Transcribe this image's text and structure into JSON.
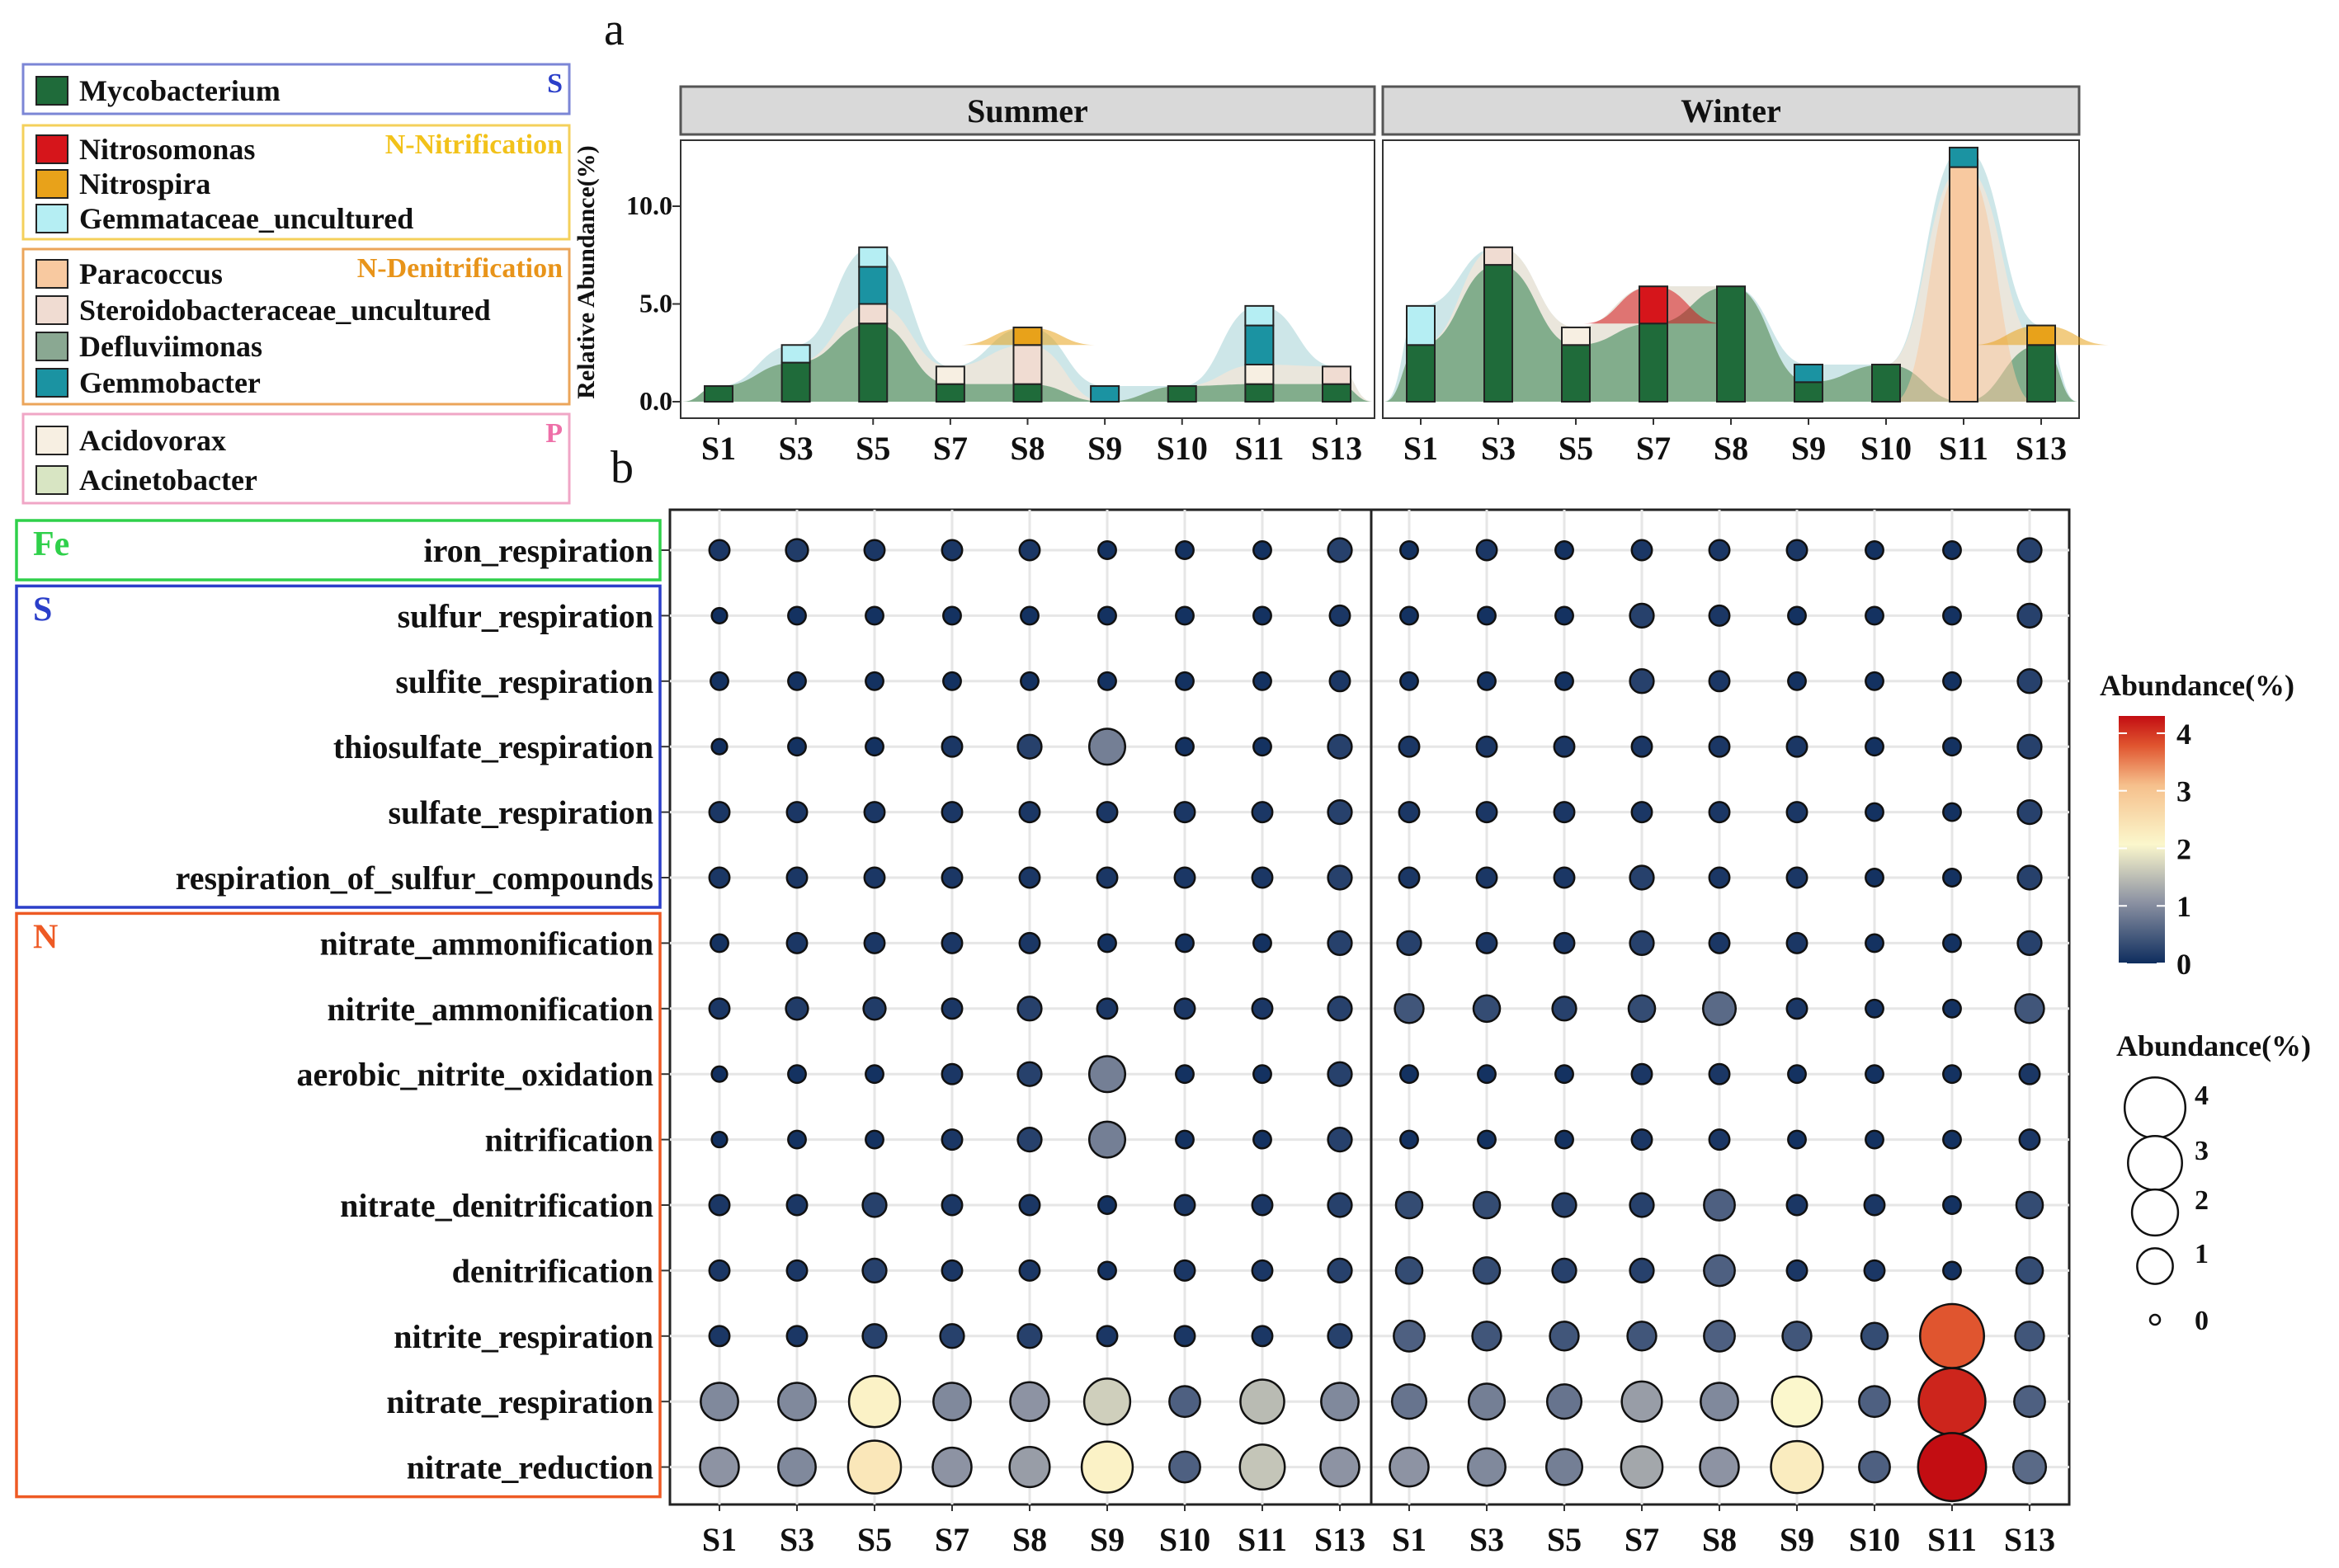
{
  "panel_labels": {
    "a": "a",
    "b": "b"
  },
  "chart_data": [
    {
      "type": "area",
      "panel": "a",
      "facets": [
        "Summer",
        "Winter"
      ],
      "ylabel": "Relative Abundance(%)",
      "ylim": [
        0,
        14
      ],
      "yticks": [
        "0.0",
        "5.0",
        "10.0"
      ],
      "categories": [
        "S1",
        "S3",
        "S5",
        "S7",
        "S8",
        "S9",
        "S10",
        "S11",
        "S13"
      ],
      "legend_groups": [
        {
          "tag": "S",
          "tag_color": "#2b3fc9",
          "border": "#7b86d6",
          "items": [
            {
              "name": "Mycobacterium",
              "color": "#1f6b3a"
            }
          ]
        },
        {
          "tag": "N-Nitrification",
          "tag_color": "#f2c21a",
          "border": "#f4d05b",
          "items": [
            {
              "name": "Nitrosomonas",
              "color": "#d6151b"
            },
            {
              "name": "Nitrospira",
              "color": "#e8a21a"
            },
            {
              "name": "Gemmataceae_uncultured",
              "color": "#b5eef3"
            }
          ]
        },
        {
          "tag": "N-Denitrification",
          "tag_color": "#e8941a",
          "border": "#eba55a",
          "items": [
            {
              "name": "Paracoccus",
              "color": "#f8c9a0"
            },
            {
              "name": "Steroidobacteraceae_uncultured",
              "color": "#f0dcd2"
            },
            {
              "name": "Defluviimonas",
              "color": "#8aa892"
            },
            {
              "name": "Gemmobacter",
              "color": "#1b93a2"
            }
          ]
        },
        {
          "tag": "P",
          "tag_color": "#ee6fa8",
          "border": "#f0a6c6",
          "items": [
            {
              "name": "Acidovorax",
              "color": "#f7efe2"
            },
            {
              "name": "Acinetobacter",
              "color": "#d8e5c3"
            }
          ]
        }
      ],
      "bars": {
        "Summer": [
          [
            {
              "taxon": "Mycobacterium",
              "value": 0.8
            }
          ],
          [
            {
              "taxon": "Mycobacterium",
              "value": 2.0
            },
            {
              "taxon": "Gemmataceae_uncultured",
              "value": 0.9
            }
          ],
          [
            {
              "taxon": "Mycobacterium",
              "value": 4.0
            },
            {
              "taxon": "Steroidobacteraceae_uncultured",
              "value": 1.0
            },
            {
              "taxon": "Gemmobacter",
              "value": 1.9
            },
            {
              "taxon": "Gemmataceae_uncultured",
              "value": 1.0
            }
          ],
          [
            {
              "taxon": "Mycobacterium",
              "value": 0.9
            },
            {
              "taxon": "Acidovorax",
              "value": 0.9
            }
          ],
          [
            {
              "taxon": "Mycobacterium",
              "value": 0.9
            },
            {
              "taxon": "Steroidobacteraceae_uncultured",
              "value": 2.0
            },
            {
              "taxon": "Nitrospira",
              "value": 0.9
            }
          ],
          [
            {
              "taxon": "Gemmobacter",
              "value": 0.8
            }
          ],
          [
            {
              "taxon": "Mycobacterium",
              "value": 0.8
            }
          ],
          [
            {
              "taxon": "Mycobacterium",
              "value": 0.9
            },
            {
              "taxon": "Acidovorax",
              "value": 1.0
            },
            {
              "taxon": "Gemmobacter",
              "value": 2.0
            },
            {
              "taxon": "Gemmataceae_uncultured",
              "value": 1.0
            }
          ],
          [
            {
              "taxon": "Mycobacterium",
              "value": 0.9
            },
            {
              "taxon": "Steroidobacteraceae_uncultured",
              "value": 0.9
            }
          ]
        ],
        "Winter": [
          [
            {
              "taxon": "Mycobacterium",
              "value": 2.9
            },
            {
              "taxon": "Gemmataceae_uncultured",
              "value": 2.0
            }
          ],
          [
            {
              "taxon": "Mycobacterium",
              "value": 7.0
            },
            {
              "taxon": "Steroidobacteraceae_uncultured",
              "value": 0.9
            }
          ],
          [
            {
              "taxon": "Mycobacterium",
              "value": 2.9
            },
            {
              "taxon": "Acidovorax",
              "value": 0.9
            }
          ],
          [
            {
              "taxon": "Mycobacterium",
              "value": 4.0
            },
            {
              "taxon": "Nitrosomonas",
              "value": 1.9
            }
          ],
          [
            {
              "taxon": "Mycobacterium",
              "value": 5.9
            }
          ],
          [
            {
              "taxon": "Mycobacterium",
              "value": 1.0
            },
            {
              "taxon": "Gemmobacter",
              "value": 0.9
            }
          ],
          [
            {
              "taxon": "Mycobacterium",
              "value": 1.9
            }
          ],
          [
            {
              "taxon": "Paracoccus",
              "value": 12.0
            },
            {
              "taxon": "Gemmobacter",
              "value": 1.0
            }
          ],
          [
            {
              "taxon": "Mycobacterium",
              "value": 2.9
            },
            {
              "taxon": "Nitrospira",
              "value": 1.0
            }
          ]
        ]
      }
    },
    {
      "type": "scatter",
      "subtype": "bubble",
      "panel": "b",
      "categories": [
        "S1",
        "S3",
        "S5",
        "S7",
        "S8",
        "S9",
        "S10",
        "S11",
        "S13"
      ],
      "facets": [
        "Summer",
        "Winter"
      ],
      "row_groups": [
        {
          "tag": "Fe",
          "color": "#2fd04a",
          "rows": [
            "iron_respiration"
          ]
        },
        {
          "tag": "S",
          "color": "#2b3fc9",
          "rows": [
            "sulfur_respiration",
            "sulfite_respiration",
            "thiosulfate_respiration",
            "sulfate_respiration",
            "respiration_of_sulfur_compounds"
          ]
        },
        {
          "tag": "N",
          "color": "#ee5a24",
          "rows": [
            "nitrate_ammonification",
            "nitrite_ammonification",
            "aerobic_nitrite_oxidation",
            "nitrification",
            "nitrate_denitrification",
            "denitrification",
            "nitrite_respiration",
            "nitrate_respiration",
            "nitrate_reduction"
          ]
        }
      ],
      "functions": [
        "iron_respiration",
        "sulfur_respiration",
        "sulfite_respiration",
        "thiosulfate_respiration",
        "sulfate_respiration",
        "respiration_of_sulfur_compounds",
        "nitrate_ammonification",
        "nitrite_ammonification",
        "aerobic_nitrite_oxidation",
        "nitrification",
        "nitrate_denitrification",
        "denitrification",
        "nitrite_respiration",
        "nitrate_respiration",
        "nitrate_reduction"
      ],
      "values": {
        "Summer": [
          [
            0.1,
            0.15,
            0.1,
            0.1,
            0.1,
            0.05,
            0.05,
            0.05,
            0.2
          ],
          [
            0.02,
            0.05,
            0.05,
            0.05,
            0.05,
            0.05,
            0.05,
            0.05,
            0.1
          ],
          [
            0.05,
            0.05,
            0.05,
            0.05,
            0.05,
            0.05,
            0.05,
            0.05,
            0.1
          ],
          [
            0.02,
            0.05,
            0.05,
            0.1,
            0.2,
            0.8,
            0.05,
            0.05,
            0.2
          ],
          [
            0.1,
            0.1,
            0.1,
            0.1,
            0.1,
            0.1,
            0.1,
            0.1,
            0.2
          ],
          [
            0.1,
            0.1,
            0.1,
            0.1,
            0.1,
            0.1,
            0.1,
            0.1,
            0.2
          ],
          [
            0.05,
            0.1,
            0.1,
            0.1,
            0.1,
            0.05,
            0.05,
            0.05,
            0.2
          ],
          [
            0.1,
            0.15,
            0.15,
            0.1,
            0.2,
            0.1,
            0.1,
            0.1,
            0.2
          ],
          [
            0.02,
            0.05,
            0.05,
            0.1,
            0.2,
            0.8,
            0.05,
            0.05,
            0.2
          ],
          [
            0.02,
            0.05,
            0.05,
            0.1,
            0.2,
            0.8,
            0.05,
            0.05,
            0.2
          ],
          [
            0.1,
            0.1,
            0.2,
            0.1,
            0.1,
            0.05,
            0.1,
            0.1,
            0.2
          ],
          [
            0.1,
            0.1,
            0.2,
            0.1,
            0.1,
            0.05,
            0.1,
            0.1,
            0.2
          ],
          [
            0.1,
            0.1,
            0.2,
            0.2,
            0.2,
            0.1,
            0.1,
            0.1,
            0.2
          ],
          [
            0.9,
            0.9,
            2.1,
            0.9,
            1.0,
            1.6,
            0.5,
            1.4,
            0.9
          ],
          [
            1.0,
            0.9,
            2.3,
            1.0,
            1.1,
            2.1,
            0.5,
            1.5,
            1.0
          ]
        ],
        "Winter": [
          [
            0.05,
            0.1,
            0.05,
            0.1,
            0.1,
            0.1,
            0.05,
            0.05,
            0.2
          ],
          [
            0.05,
            0.05,
            0.05,
            0.2,
            0.1,
            0.05,
            0.05,
            0.05,
            0.2
          ],
          [
            0.05,
            0.05,
            0.05,
            0.2,
            0.1,
            0.05,
            0.05,
            0.05,
            0.2
          ],
          [
            0.1,
            0.1,
            0.1,
            0.1,
            0.1,
            0.1,
            0.05,
            0.05,
            0.2
          ],
          [
            0.1,
            0.1,
            0.1,
            0.1,
            0.1,
            0.1,
            0.05,
            0.05,
            0.2
          ],
          [
            0.1,
            0.1,
            0.1,
            0.2,
            0.1,
            0.1,
            0.05,
            0.05,
            0.2
          ],
          [
            0.2,
            0.1,
            0.1,
            0.2,
            0.1,
            0.1,
            0.05,
            0.05,
            0.2
          ],
          [
            0.4,
            0.3,
            0.2,
            0.3,
            0.6,
            0.1,
            0.05,
            0.05,
            0.4
          ],
          [
            0.05,
            0.05,
            0.05,
            0.1,
            0.1,
            0.05,
            0.05,
            0.05,
            0.1
          ],
          [
            0.05,
            0.05,
            0.05,
            0.1,
            0.1,
            0.05,
            0.05,
            0.05,
            0.1
          ],
          [
            0.3,
            0.3,
            0.2,
            0.2,
            0.5,
            0.1,
            0.1,
            0.05,
            0.3
          ],
          [
            0.3,
            0.3,
            0.2,
            0.2,
            0.5,
            0.1,
            0.1,
            0.05,
            0.3
          ],
          [
            0.5,
            0.4,
            0.4,
            0.4,
            0.5,
            0.4,
            0.3,
            3.7,
            0.4
          ],
          [
            0.7,
            0.8,
            0.7,
            1.1,
            0.9,
            2.0,
            0.5,
            4.1,
            0.5
          ],
          [
            1.0,
            0.9,
            0.8,
            1.2,
            1.0,
            2.2,
            0.5,
            4.3,
            0.6
          ]
        ]
      },
      "color_legend": {
        "title": "Abundance(%)",
        "ticks": [
          "4",
          "3",
          "2",
          "1",
          "0"
        ],
        "range": [
          0,
          4.3
        ]
      },
      "size_legend": {
        "title": "Abundance(%)",
        "labels": [
          "4",
          "3",
          "2",
          "1",
          "0"
        ],
        "values": [
          4,
          3,
          2,
          1,
          0
        ]
      }
    }
  ]
}
